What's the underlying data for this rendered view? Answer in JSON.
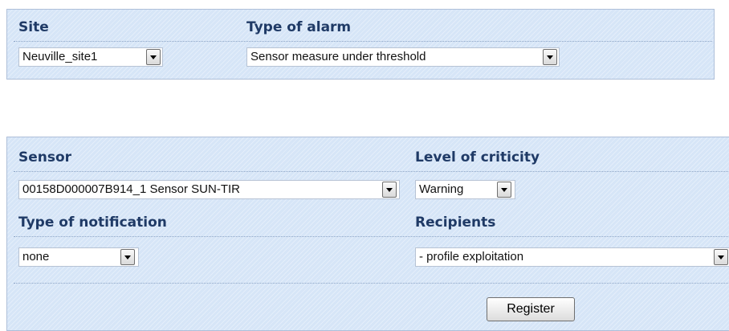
{
  "top_panel": {
    "site_label": "Site",
    "site_value": "Neuville_site1",
    "type_label": "Type of alarm",
    "type_value": "Sensor measure under threshold"
  },
  "bottom_panel": {
    "sensor_label": "Sensor",
    "sensor_value": "00158D000007B914_1 Sensor SUN-TIR",
    "criticity_label": "Level of criticity",
    "criticity_value": "Warning",
    "notification_label": "Type of notification",
    "notification_value": "none",
    "recipients_label": "Recipients",
    "recipients_value": "- profile exploitation",
    "register_label": "Register"
  },
  "icons": {
    "dropdown": "chevron-down-icon"
  },
  "colors": {
    "panel_bg": "#d6e5f7",
    "label_color": "#1f3a66",
    "panel_border": "#aebfd9"
  }
}
